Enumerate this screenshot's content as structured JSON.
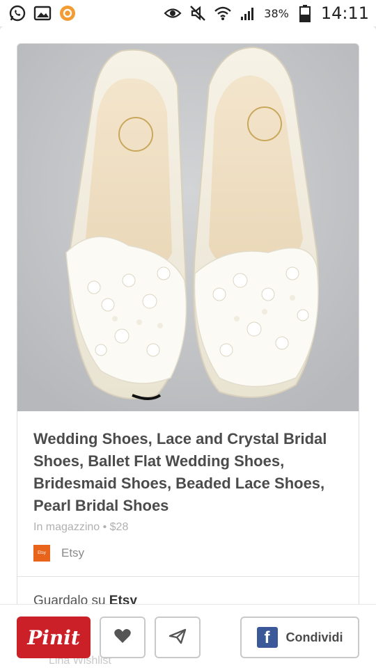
{
  "status_bar": {
    "battery": "38%",
    "time": "14:11",
    "icons": [
      "whatsapp-icon",
      "gallery-icon",
      "app-notification-icon",
      "eye-icon",
      "mute-icon",
      "wifi-icon",
      "signal-icon",
      "battery-icon"
    ]
  },
  "pin": {
    "image_alt": "Ivory lace ballet flat wedding shoes with pearls",
    "title": "Wedding Shoes, Lace and Crystal Bridal Shoes, Ballet Flat Wedding Shoes, Bridesmaid Shoes, Beaded Lace Shoes, Pearl Bridal Shoes",
    "meta": "In magazzino • $28",
    "source": {
      "logo_text": "Etsy",
      "name": "Etsy"
    },
    "see_on_prefix": "Guardalo su",
    "see_on_site": "Etsy"
  },
  "action_bar": {
    "pinit_label": "Pinit",
    "share_label": "Condividi",
    "ghost_text": "Lina Wishlist"
  },
  "colors": {
    "pinterest_red": "#cb2027",
    "facebook_blue": "#3b5998",
    "etsy_orange": "#e8641b"
  }
}
